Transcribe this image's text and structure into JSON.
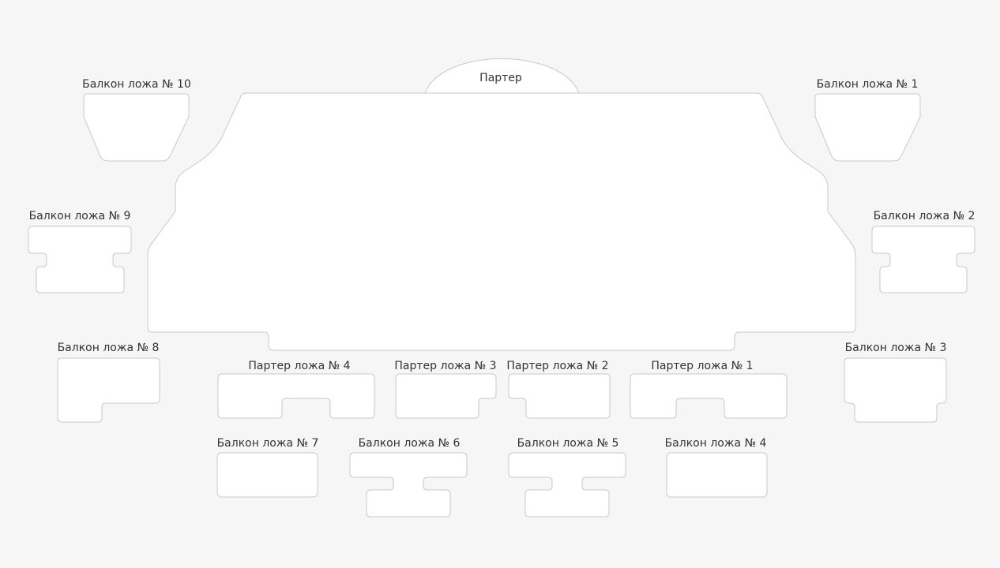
{
  "hall": {
    "zones": {
      "parter": "Партер",
      "balcony_box_1": "Балкон ложа № 1",
      "balcony_box_2": "Балкон ложа № 2",
      "balcony_box_3": "Балкон ложа № 3",
      "balcony_box_4": "Балкон ложа № 4",
      "balcony_box_5": "Балкон ложа № 5",
      "balcony_box_6": "Балкон ложа № 6",
      "balcony_box_7": "Балкон ложа № 7",
      "balcony_box_8": "Балкон ложа № 8",
      "balcony_box_9": "Балкон ложа № 9",
      "balcony_box_10": "Балкон ложа № 10",
      "parter_box_1": "Партер ложа № 1",
      "parter_box_2": "Партер ложа № 2",
      "parter_box_3": "Партер ложа № 3",
      "parter_box_4": "Партер ложа № 4"
    }
  },
  "colors": {
    "background": "#f6f6f6",
    "zone_fill": "#ffffff",
    "zone_stroke": "#c9c9c9",
    "label_text": "#333333"
  }
}
